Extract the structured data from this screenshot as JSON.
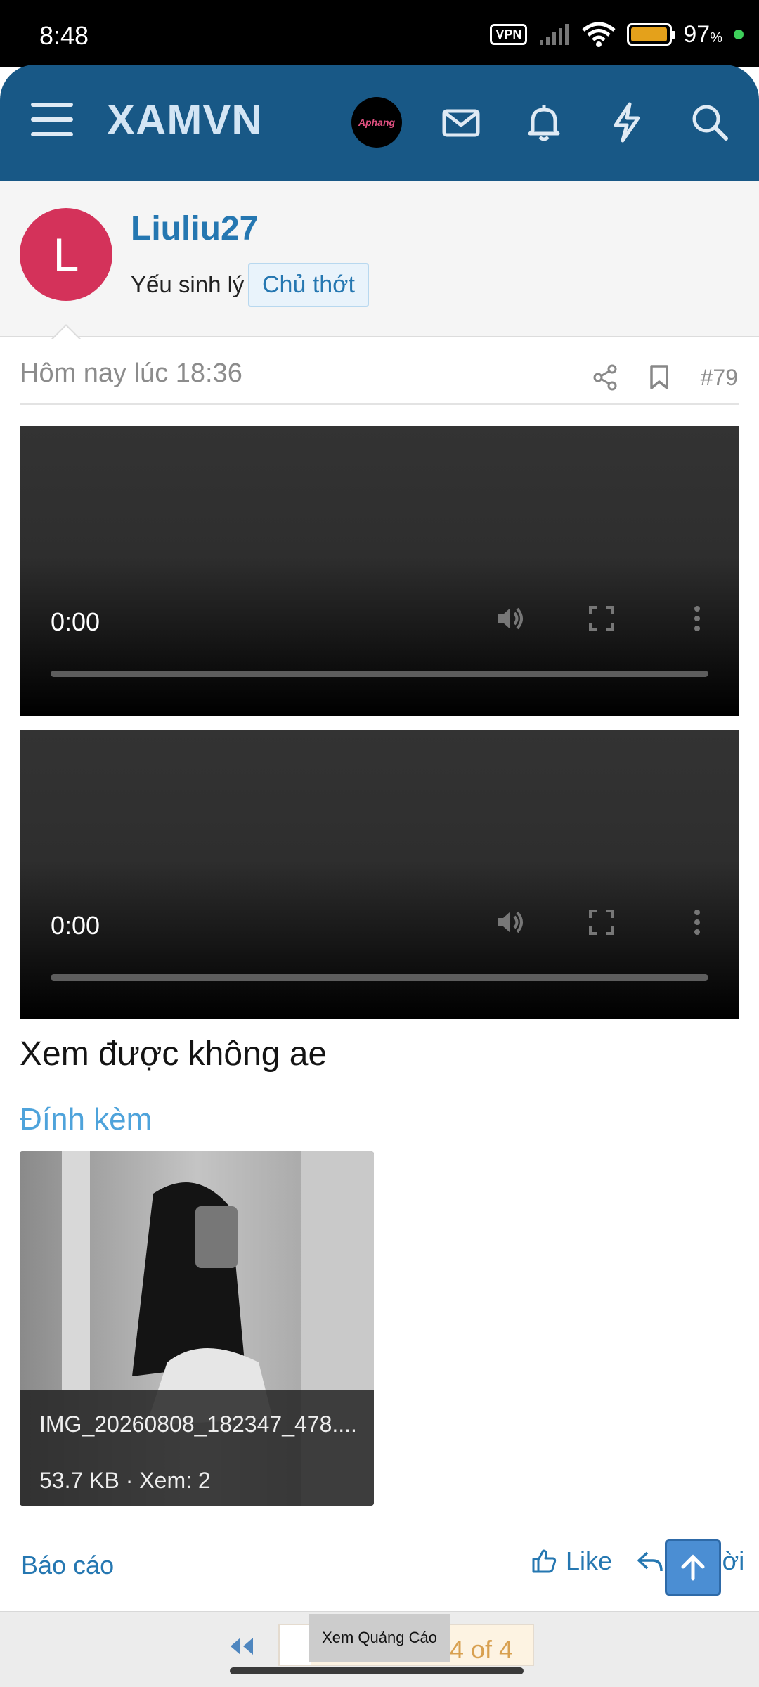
{
  "status_bar": {
    "time": "8:48",
    "vpn": "VPN",
    "battery": "97",
    "battery_unit": "%",
    "battery_level": 0.97
  },
  "header": {
    "logo": "XAMVN",
    "avatar_text": "Aphang",
    "icons": [
      "menu-icon",
      "mail-icon",
      "bell-icon",
      "lightning-icon",
      "search-icon"
    ]
  },
  "post": {
    "avatar_letter": "L",
    "username": "Liuliu27",
    "user_title": "Yếu sinh lý",
    "badge": "Chủ thớt",
    "timestamp": "Hôm nay lúc 18:36",
    "post_number": "#79",
    "videos": [
      {
        "time": "0:00"
      },
      {
        "time": "0:00"
      }
    ],
    "text": "Xem được không ae",
    "attachments_title": "Đính kèm",
    "attachment": {
      "name": "IMG_20260808_182347_478....",
      "info": "53.7 KB · Xem: 2"
    },
    "report": "Báo cáo",
    "like": "Like",
    "reply": "Trả lời"
  },
  "footer": {
    "page_label": "4 of 4",
    "ad_button": "Xem Quảng Cáo"
  },
  "colors": {
    "header": "#185886",
    "link": "#2577b1",
    "avatar": "#d4325a",
    "accent": "#4ea3db"
  }
}
